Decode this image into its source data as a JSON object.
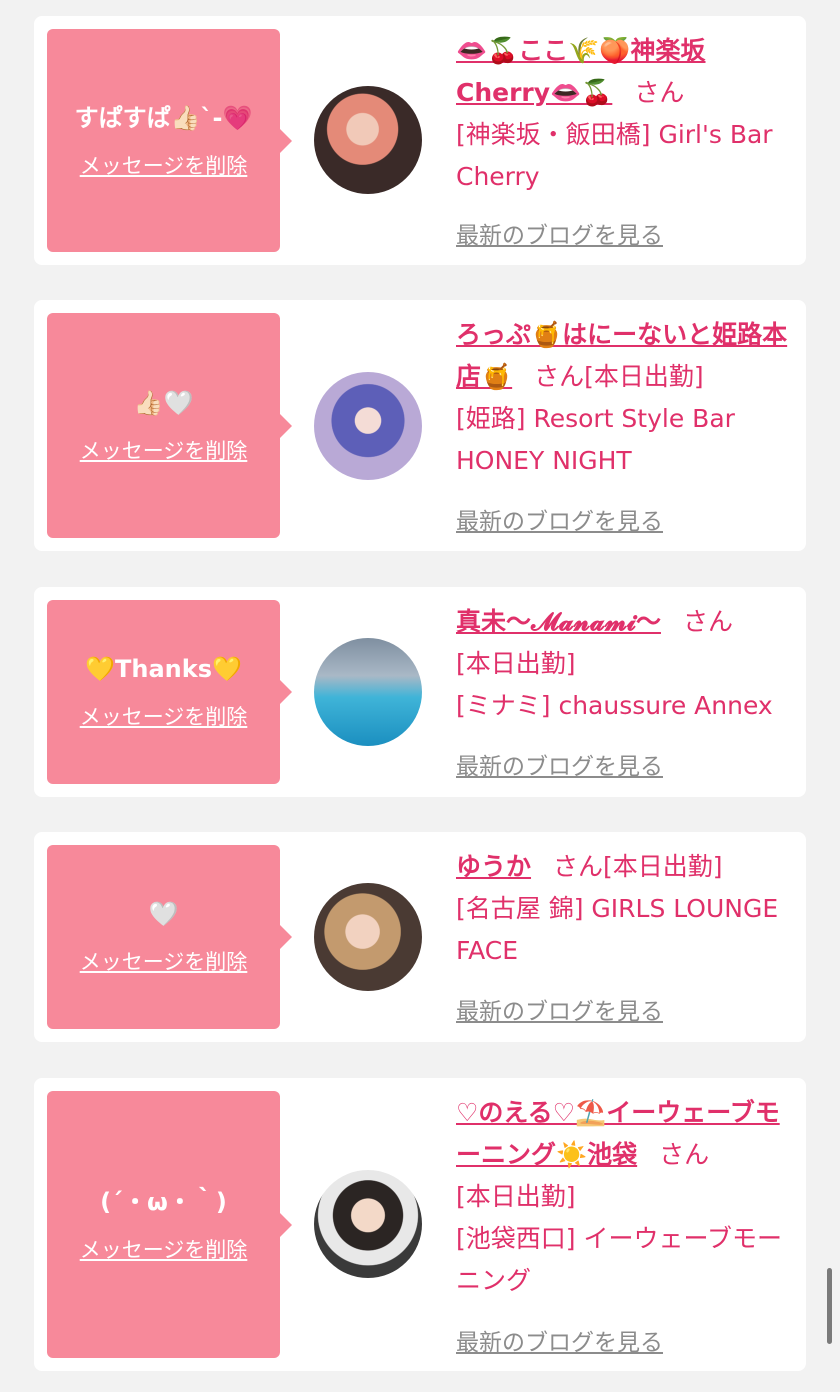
{
  "cards": [
    {
      "message": "すぱすぱ👍🏻ˋ-💗",
      "delete_label": "メッセージを削除",
      "name": "👄🍒ここ🌾🍑神楽坂Cherry👄🍒",
      "san": "さん",
      "status": "",
      "shop": "[神楽坂・飯田橋] Girl's Bar Cherry",
      "blog_label": "最新のブログを見る"
    },
    {
      "message": "👍🏻🤍",
      "delete_label": "メッセージを削除",
      "name": "ろっぷ🍯はにーないと姫路本店🍯",
      "san": "さん",
      "status": "[本日出勤]",
      "shop": "[姫路] Resort Style Bar HONEY NIGHT",
      "blog_label": "最新のブログを見る"
    },
    {
      "message": "💛Thanks💛",
      "delete_label": "メッセージを削除",
      "name": "真未〜𝓜𝓪𝓷𝓪𝓶𝓲〜",
      "san": "さん",
      "status": "[本日出勤]",
      "shop": "[ミナミ] chaussure Annex",
      "blog_label": "最新のブログを見る"
    },
    {
      "message": "🤍",
      "delete_label": "メッセージを削除",
      "name": "ゆうか",
      "san": "さん",
      "status": "[本日出勤]",
      "shop": "[名古屋 錦] GIRLS LOUNGE FACE",
      "blog_label": "最新のブログを見る"
    },
    {
      "message": "(´・ω・｀)",
      "delete_label": "メッセージを削除",
      "name": "♡のえる♡⛱️イーウェーブモーニング☀️池袋",
      "san": "さん",
      "status": "[本日出勤]",
      "shop": "[池袋西口] イーウェーブモーニング",
      "blog_label": "最新のブログを見る"
    }
  ],
  "colors": {
    "accent": "#e0306a",
    "bubble": "#f7899a",
    "muted": "#8c8c8c",
    "background": "#f2f2f2"
  },
  "icons": [
    "avatar-photo",
    "scrollbar"
  ]
}
